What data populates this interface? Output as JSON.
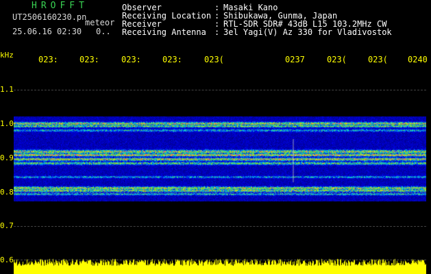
{
  "header": {
    "app_title": "HROFFT",
    "filename": "UT2506160230.pn",
    "meteor_label": "meteor",
    "date_time": "25.06.16 02:30",
    "counter": "0..",
    "fields": [
      {
        "label": "Observer",
        "sep": ":",
        "value": "Masaki Kano"
      },
      {
        "label": "Receiving Location",
        "sep": ":",
        "value": "Shibukawa, Gunma, Japan"
      },
      {
        "label": "Receiver",
        "sep": ":",
        "value": "RTL-SDR SDR# 43dB L15 103.2MHz CW"
      },
      {
        "label": "Receiving Antenna",
        "sep": ":",
        "value": "3el Yagi(V) Az 330 for Vladivostok"
      }
    ]
  },
  "spectrogram": {
    "y_unit_label": "kHz",
    "y_labels": [
      "1.1",
      "1.0",
      "0.9",
      "0.8",
      "0.7",
      "0.6"
    ],
    "x_labels": [
      "023:",
      "023:",
      "023:",
      "023:",
      "023(",
      "0237",
      "023(",
      "023(",
      "0240"
    ],
    "colors": {
      "background": "#000000",
      "accent": "#ffff00",
      "title": "#39d353"
    }
  }
}
